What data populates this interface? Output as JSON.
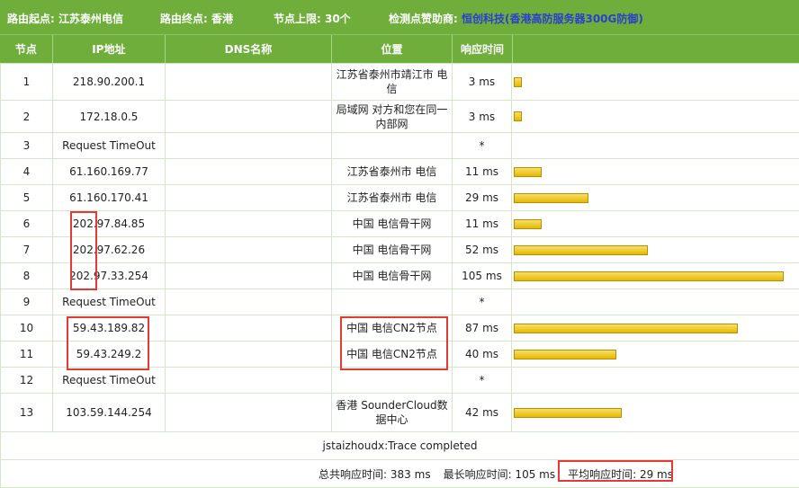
{
  "header": {
    "start_label": "路由起点: ",
    "start_value": "江苏泰州电信",
    "end_label": "路由终点: ",
    "end_value": "香港",
    "limit_label": "节点上限: ",
    "limit_value": "30个",
    "sponsor_label": "检测点赞助商: ",
    "sponsor_name": "恒创科技",
    "sponsor_detail": "(香港高防服务器300G防御)"
  },
  "columns": [
    "节点",
    "IP地址",
    "DNS名称",
    "位置",
    "响应时间",
    ""
  ],
  "rows": [
    {
      "node": "1",
      "ip": "218.90.200.1",
      "dns": "",
      "location": "江苏省泰州市靖江市 电信",
      "time": "3 ms",
      "time_ms": 3
    },
    {
      "node": "2",
      "ip": "172.18.0.5",
      "dns": "",
      "location": "局域网 对方和您在同一内部网",
      "time": "3 ms",
      "time_ms": 3
    },
    {
      "node": "3",
      "ip": "Request TimeOut",
      "dns": "",
      "location": "",
      "time": "*",
      "time_ms": 0
    },
    {
      "node": "4",
      "ip": "61.160.169.77",
      "dns": "",
      "location": "江苏省泰州市 电信",
      "time": "11 ms",
      "time_ms": 11
    },
    {
      "node": "5",
      "ip": "61.160.170.41",
      "dns": "",
      "location": "江苏省泰州市 电信",
      "time": "29 ms",
      "time_ms": 29
    },
    {
      "node": "6",
      "ip": "202.97.84.85",
      "dns": "",
      "location": "中国 电信骨干网",
      "time": "11 ms",
      "time_ms": 11
    },
    {
      "node": "7",
      "ip": "202.97.62.26",
      "dns": "",
      "location": "中国 电信骨干网",
      "time": "52 ms",
      "time_ms": 52
    },
    {
      "node": "8",
      "ip": "202.97.33.254",
      "dns": "",
      "location": "中国 电信骨干网",
      "time": "105 ms",
      "time_ms": 105
    },
    {
      "node": "9",
      "ip": "Request TimeOut",
      "dns": "",
      "location": "",
      "time": "*",
      "time_ms": 0
    },
    {
      "node": "10",
      "ip": "59.43.189.82",
      "dns": "",
      "location": "中国 电信CN2节点",
      "time": "87 ms",
      "time_ms": 87
    },
    {
      "node": "11",
      "ip": "59.43.249.2",
      "dns": "",
      "location": "中国 电信CN2节点",
      "time": "40 ms",
      "time_ms": 40
    },
    {
      "node": "12",
      "ip": "Request TimeOut",
      "dns": "",
      "location": "",
      "time": "*",
      "time_ms": 0
    },
    {
      "node": "13",
      "ip": "103.59.144.254",
      "dns": "",
      "location": "香港 SounderCloud数据中心",
      "time": "42 ms",
      "time_ms": 42
    }
  ],
  "trace_status": "jstaizhoudx:Trace completed",
  "summary": {
    "total": "总共响应时间: 383 ms",
    "max": "最长响应时间: 105 ms",
    "avg": "平均响应时间:  29 ms"
  },
  "colors": {
    "header_bg": "#6fae3b",
    "bar": "#f2d03b",
    "highlight": "#e53935"
  }
}
